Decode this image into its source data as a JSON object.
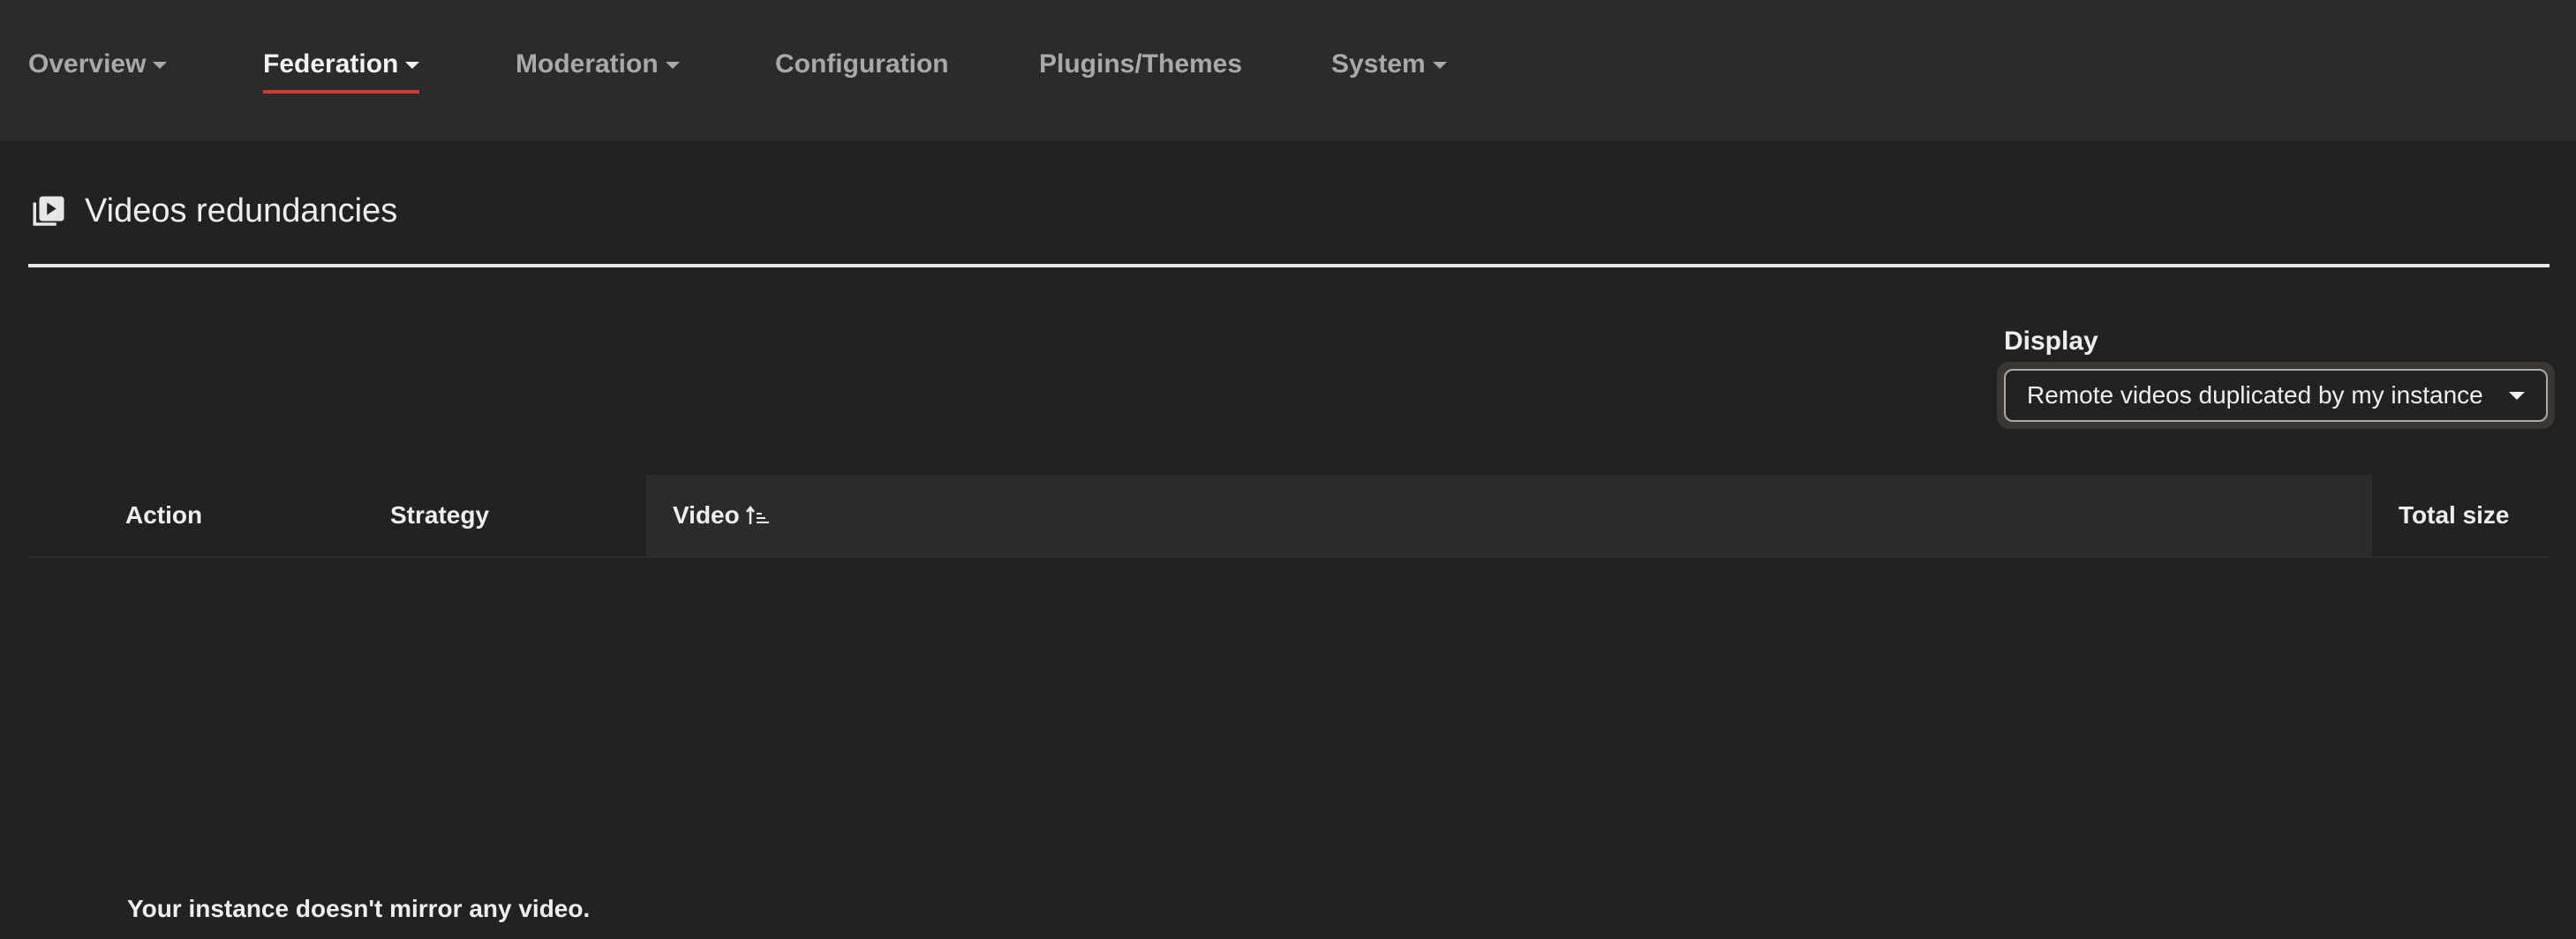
{
  "nav": {
    "items": [
      {
        "label": "Overview",
        "dropdown": true
      },
      {
        "label": "Federation",
        "dropdown": true,
        "active": true
      },
      {
        "label": "Moderation",
        "dropdown": true
      },
      {
        "label": "Configuration"
      },
      {
        "label": "Plugins/Themes"
      },
      {
        "label": "System",
        "dropdown": true
      }
    ],
    "accent_color": "#d33a31"
  },
  "page": {
    "title": "Videos redundancies",
    "title_icon": "video-library-icon"
  },
  "display": {
    "label": "Display",
    "selected": "Remote videos duplicated by my instance"
  },
  "table": {
    "columns": [
      "Action",
      "Strategy",
      "Video",
      "Total size"
    ],
    "sort_icon": "sort-ascending-icon",
    "empty_message": "Your instance doesn't mirror any video."
  }
}
